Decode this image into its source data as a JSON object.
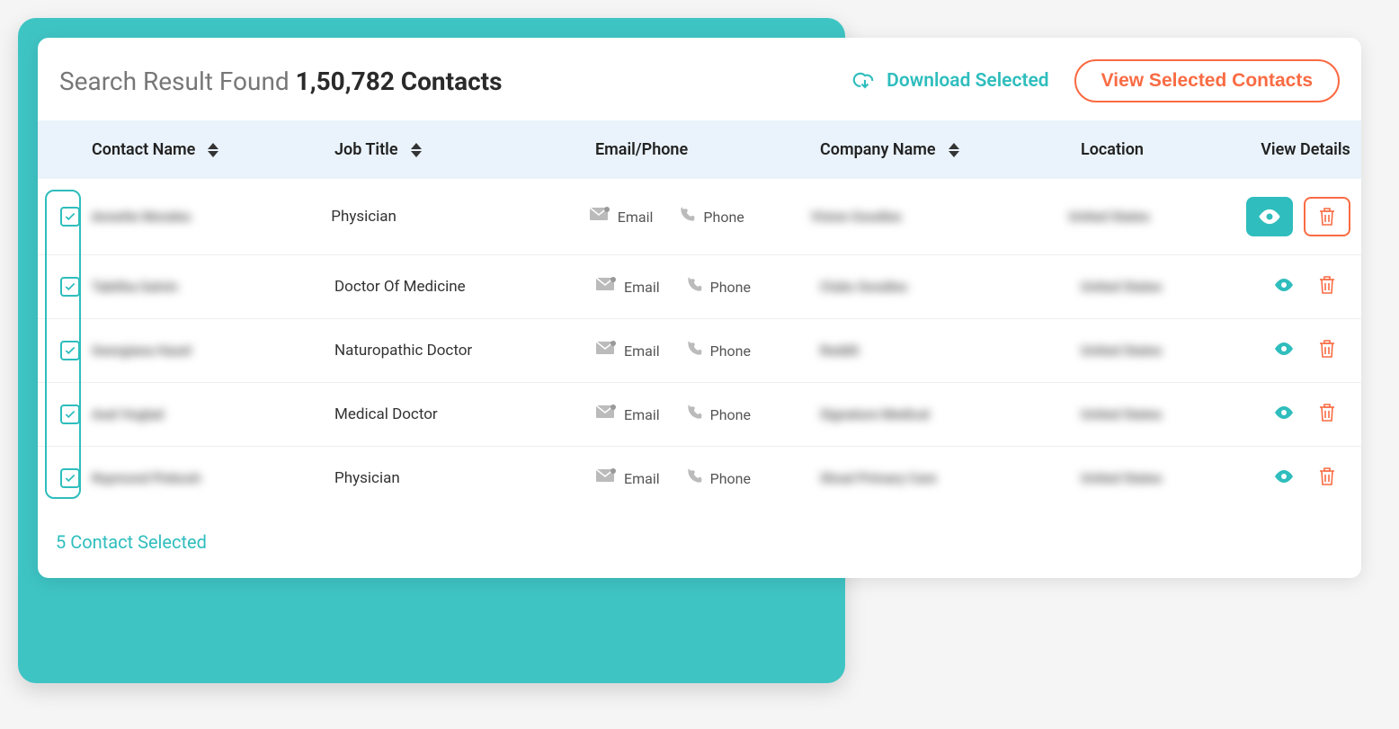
{
  "header": {
    "title_prefix": "Search Result Found ",
    "count_text": "1,50,782 Contacts",
    "download_label": "Download Selected",
    "view_selected_label": "View Selected Contacts"
  },
  "columns": {
    "contact_name": "Contact Name",
    "job_title": "Job Title",
    "email_phone": "Email/Phone",
    "company_name": "Company Name",
    "location": "Location",
    "view_details": "View Details"
  },
  "labels": {
    "email": "Email",
    "phone": "Phone"
  },
  "rows": [
    {
      "contact_name": "Annette Morales",
      "job_title": "Physician",
      "company": "Vision Goodies",
      "location": "United States",
      "primary": true
    },
    {
      "contact_name": "Tabitha Galvin",
      "job_title": "Doctor Of Medicine",
      "company": "Clubs Goodies",
      "location": "United States",
      "primary": false
    },
    {
      "contact_name": "Georgiana Hazel",
      "job_title": "Naturopathic Doctor",
      "company": "Reddit",
      "location": "United States",
      "primary": false
    },
    {
      "contact_name": "Axel Voglad",
      "job_title": "Medical Doctor",
      "company": "Signature Medical",
      "location": "United States",
      "primary": false
    },
    {
      "contact_name": "Raymond Pinkosh",
      "job_title": "Physician",
      "company": "Shoal Primary Care",
      "location": "United States",
      "primary": false
    }
  ],
  "footer": {
    "selected_text": "5 Contact Selected"
  }
}
